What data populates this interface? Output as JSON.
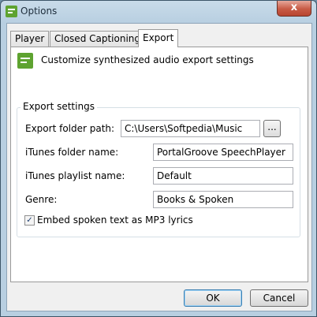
{
  "window": {
    "title": "Options",
    "close_symbol": "x"
  },
  "tabs": [
    {
      "label": "Player"
    },
    {
      "label": "Closed Captioning"
    },
    {
      "label": "Export"
    }
  ],
  "active_tab": "Export",
  "header": {
    "icon": "chat-bubble-icon",
    "text": "Customize synthesized audio export settings"
  },
  "export_settings": {
    "legend": "Export settings",
    "export_folder_path": {
      "label": "Export folder path:",
      "value": "C:\\Users\\Softpedia\\Music",
      "browse_label": "..."
    },
    "itunes_folder_name": {
      "label": "iTunes folder name:",
      "value": "PortalGroove SpeechPlayer"
    },
    "itunes_playlist_name": {
      "label": "iTunes playlist name:",
      "value": "Default"
    },
    "genre": {
      "label": "Genre:",
      "value": "Books & Spoken"
    },
    "embed_lyrics": {
      "label": "Embed spoken text as MP3 lyrics",
      "checked": true,
      "check_mark": "✓"
    }
  },
  "footer": {
    "ok_label": "OK",
    "cancel_label": "Cancel"
  },
  "colors": {
    "accent_green": "#5ea330",
    "title_bar": "#b8cfe1",
    "close_button": "#c75a45"
  }
}
